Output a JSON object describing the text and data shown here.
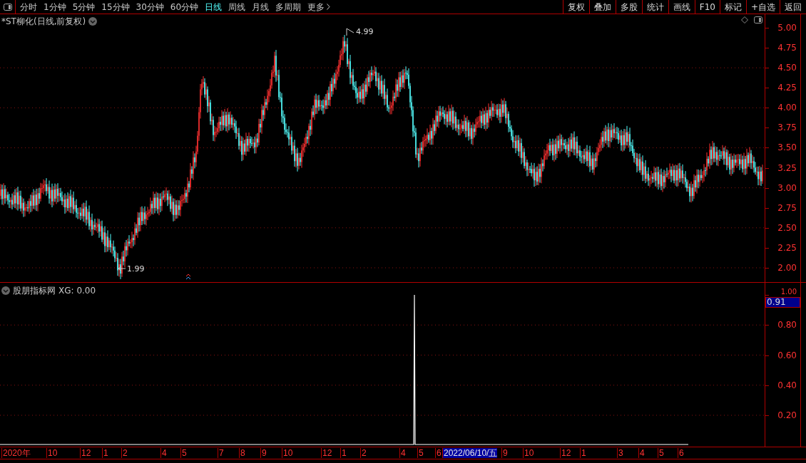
{
  "toolbar": {
    "periods": [
      {
        "label": "分时",
        "selected": false
      },
      {
        "label": "1分钟",
        "selected": false
      },
      {
        "label": "5分钟",
        "selected": false
      },
      {
        "label": "15分钟",
        "selected": false
      },
      {
        "label": "30分钟",
        "selected": false
      },
      {
        "label": "60分钟",
        "selected": false
      },
      {
        "label": "日线",
        "selected": true
      },
      {
        "label": "周线",
        "selected": false
      },
      {
        "label": "月线",
        "selected": false
      },
      {
        "label": "多周期",
        "selected": false
      },
      {
        "label": "更多",
        "selected": false
      }
    ],
    "buttons": [
      "复权",
      "叠加",
      "多股",
      "统计",
      "画线",
      "F10",
      "标记",
      "+自选",
      "返回"
    ]
  },
  "chart": {
    "title": "*ST柳化(日线,前复权)",
    "high_label": "4.99",
    "low_label": "1.99",
    "price_ticks": [
      "5.00",
      "4.75",
      "4.50",
      "4.25",
      "4.00",
      "3.75",
      "3.50",
      "3.25",
      "3.00",
      "2.75",
      "2.50",
      "2.25",
      "2.00"
    ]
  },
  "indicator": {
    "title": "股朋指标网",
    "reading": "XG: 0.00",
    "ticks": [
      "1.00",
      "0.80",
      "0.60",
      "0.40",
      "0.20"
    ],
    "cursor_value": "0.91"
  },
  "date_axis": [
    {
      "label": "2020年",
      "selected": false
    },
    {
      "label": "10",
      "selected": false
    },
    {
      "label": "12",
      "selected": false
    },
    {
      "label": "1",
      "selected": false
    },
    {
      "label": "2",
      "selected": false
    },
    {
      "label": "4",
      "selected": false
    },
    {
      "label": "5",
      "selected": false
    },
    {
      "label": "7",
      "selected": false
    },
    {
      "label": "8",
      "selected": false
    },
    {
      "label": "9",
      "selected": false
    },
    {
      "label": "10",
      "selected": false
    },
    {
      "label": "12",
      "selected": false
    },
    {
      "label": "1",
      "selected": false
    },
    {
      "label": "2",
      "selected": false
    },
    {
      "label": "4",
      "selected": false
    },
    {
      "label": "5",
      "selected": false
    },
    {
      "label": "6",
      "selected": false
    },
    {
      "label": "2022/06/10/五",
      "selected": true
    },
    {
      "label": "9",
      "selected": false
    },
    {
      "label": "10",
      "selected": false
    },
    {
      "label": "12",
      "selected": false
    },
    {
      "label": "1",
      "selected": false
    },
    {
      "label": "3",
      "selected": false
    },
    {
      "label": "4",
      "selected": false
    },
    {
      "label": "5",
      "selected": false
    },
    {
      "label": "6",
      "selected": false
    }
  ]
}
